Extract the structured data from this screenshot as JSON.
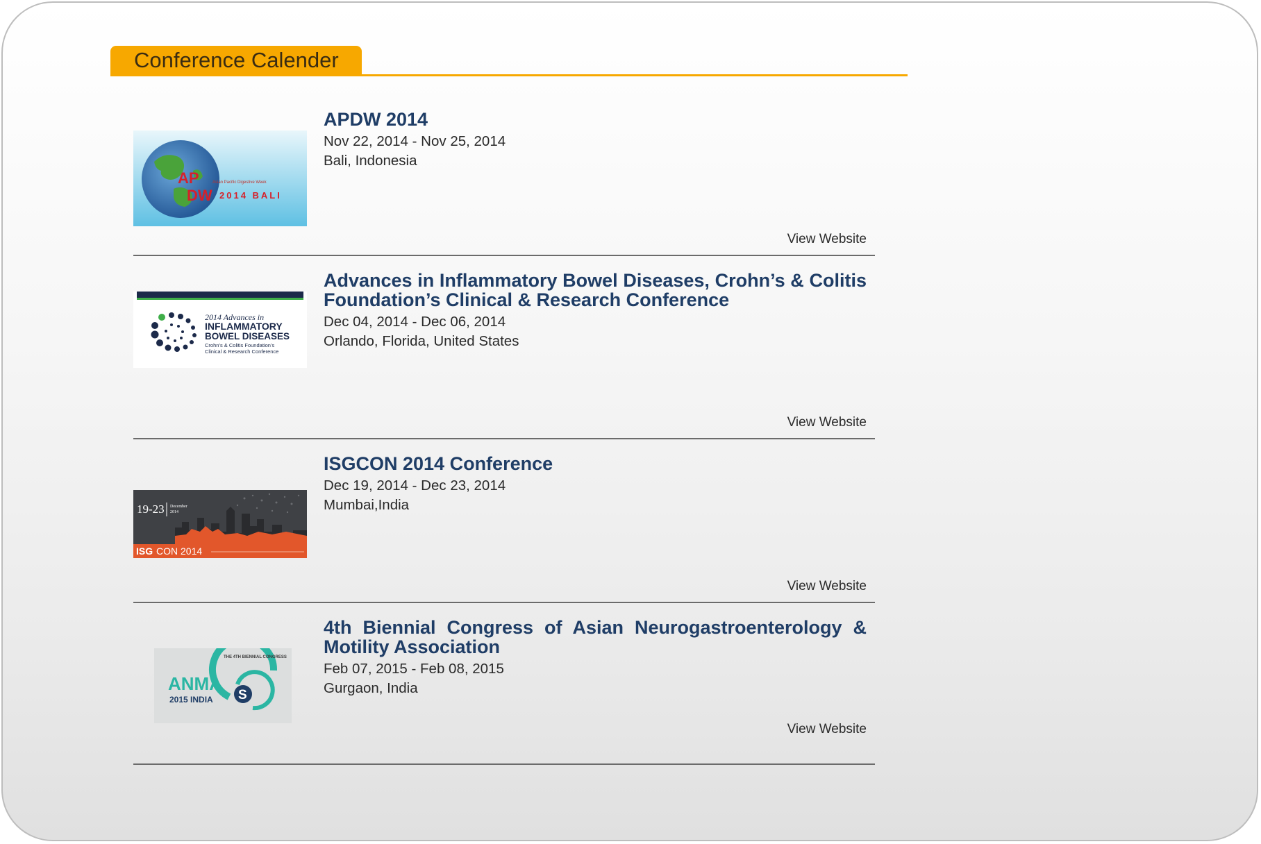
{
  "section": {
    "title": "Conference Calender"
  },
  "conferences": [
    {
      "title": "APDW 2014",
      "dates": "Nov 22, 2014 - Nov 25, 2014",
      "location": "Bali, Indonesia",
      "link_label": "View Website",
      "logo": {
        "line1": "AP",
        "line2": "DW",
        "tagline": "Asian Pacific Digestive Week",
        "place": "2014 BALI"
      }
    },
    {
      "title": "Advances in Inflammatory Bowel Diseases, Crohn’s & Colitis Foundation’s Clinical & Research Conference",
      "dates": "Dec 04, 2014 - Dec 06, 2014",
      "location": "Orlando, Florida, United States",
      "link_label": "View Website",
      "logo": {
        "line1": "2014 Advances in",
        "line2": "INFLAMMATORY",
        "line3": "BOWEL DISEASES",
        "line4": "Crohn’s & Colitis Foundation’s",
        "line5": "Clinical & Research Conference"
      }
    },
    {
      "title": "ISGCON 2014 Conference",
      "dates": "Dec 19, 2014 - Dec 23, 2014",
      "location": "Mumbai,India",
      "link_label": "View Website",
      "logo": {
        "days": "19-23",
        "month": "December",
        "year": "2014",
        "brand_a": "ISG",
        "brand_b": "CON 2014"
      }
    },
    {
      "title": "4th Biennial Congress of Asian Neurogastroenterology & Motility Association",
      "dates": "Feb 07, 2015 - Feb 08, 2015",
      "location": "Gurgaon, India",
      "link_label": "View Website",
      "logo": {
        "name": "ANMA",
        "sub": "2015 INDIA",
        "arc": "THE 4TH BIENNIAL CONGRESS"
      }
    }
  ],
  "colors": {
    "accent": "#f7a800",
    "title_text": "#1f3d66",
    "divider": "#6b6b6b"
  }
}
